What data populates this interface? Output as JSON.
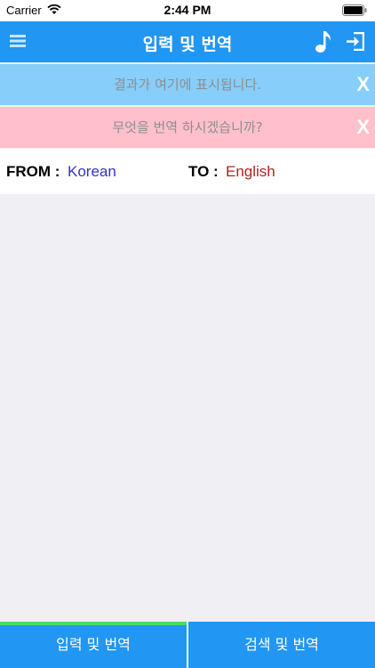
{
  "status_bar": {
    "carrier": "Carrier",
    "time": "2:44 PM"
  },
  "nav": {
    "title": "입력 및 번역"
  },
  "banners": {
    "result_placeholder": "결과가 여기에 표시됩니다.",
    "input_placeholder": "무엇을 번역 하시겠습니까?",
    "close_label": "X"
  },
  "languages": {
    "from_label": "FROM :",
    "from_value": "Korean",
    "to_label": "TO :",
    "to_value": "English"
  },
  "tabs": {
    "input_translate": "입력 및 번역",
    "search_translate": "검색 및 번역"
  },
  "colors": {
    "accent": "#2196f3",
    "result_banner": "#87cefa",
    "input_banner": "#ffc0cb",
    "from_lang": "#3333cc",
    "to_lang": "#b22222",
    "active_tab_indicator": "#4cd964"
  },
  "icons": [
    "wifi-icon",
    "battery-icon",
    "menu-icon",
    "music-note-icon",
    "sign-in-icon"
  ]
}
